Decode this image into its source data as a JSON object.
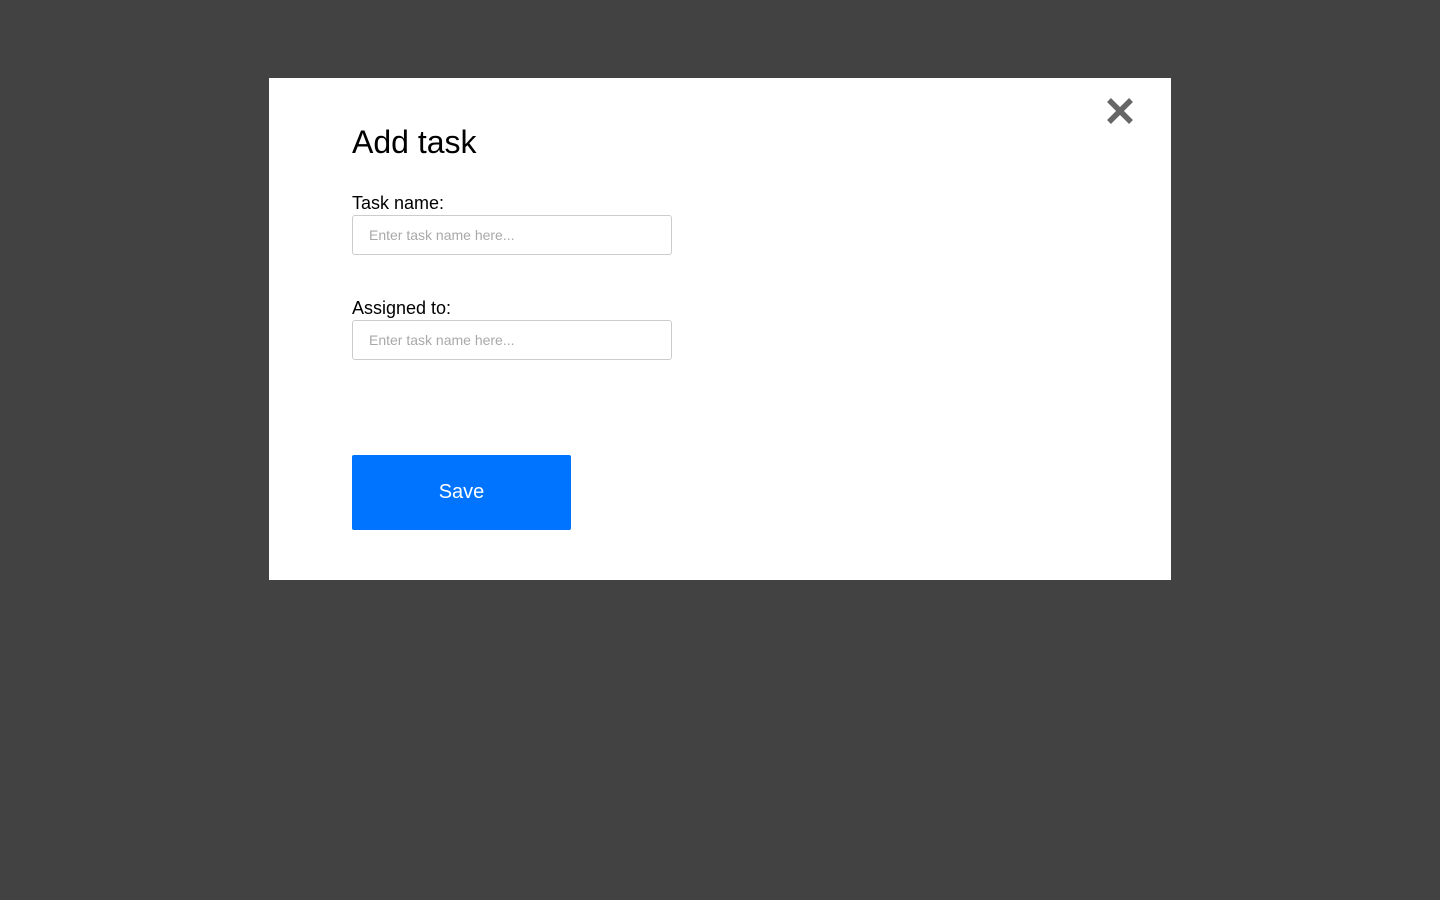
{
  "modal": {
    "title": "Add task",
    "close_icon": "close-icon",
    "fields": {
      "task_name": {
        "label": "Task name:",
        "value": "",
        "placeholder": "Enter task name here..."
      },
      "assigned_to": {
        "label": "Assigned to:",
        "value": "",
        "placeholder": "Enter task name here..."
      }
    },
    "save_label": "Save"
  },
  "colors": {
    "backdrop": "#424242",
    "modal_bg": "#ffffff",
    "primary": "#0074ff",
    "close_icon": "#666666"
  }
}
